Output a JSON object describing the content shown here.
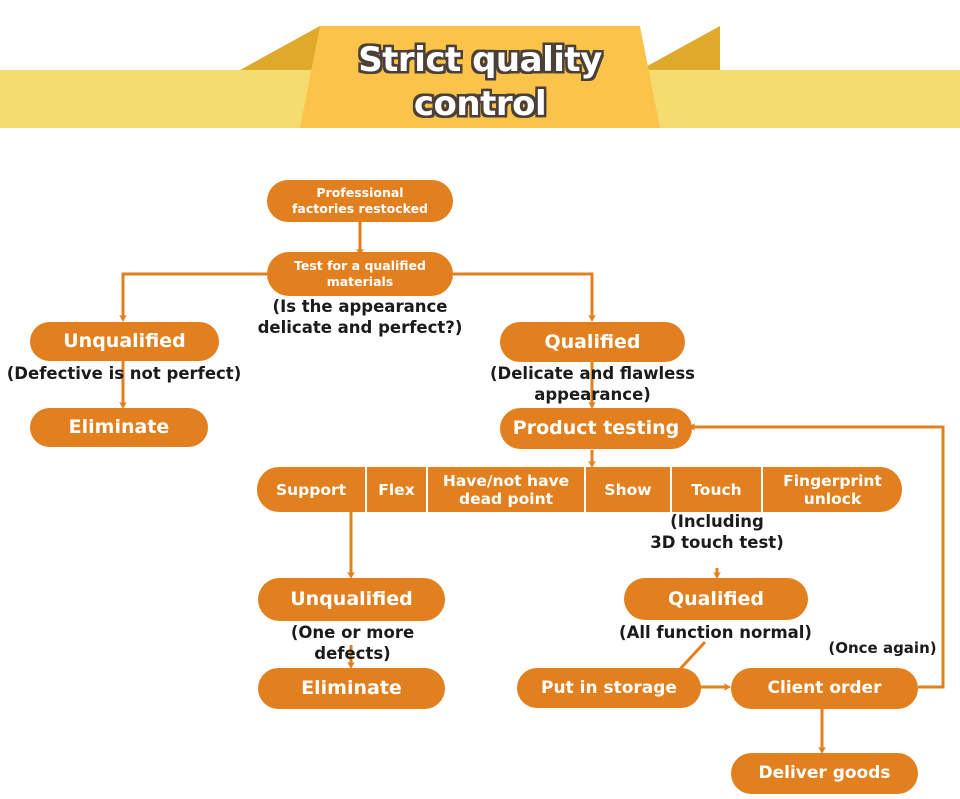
{
  "header": {
    "title": "Strict quality\ncontrol",
    "banner_light_color": "#F5DC6E",
    "banner_mid_color": "#FBC44A",
    "banner_dark_color": "#DFA92B"
  },
  "theme": {
    "pill_color": "#E2801F",
    "connector_color": "#E2801F",
    "caption_color": "#1b1b1b",
    "background": "#ffffff"
  },
  "flow": {
    "nodes": {
      "restocked": "Professional\nfactories restocked",
      "test_materials": "Test for a qualified\nmaterials",
      "unqualified_top": "Unqualified",
      "qualified_top": "Qualified",
      "eliminate_top": "Eliminate",
      "product_testing": "Product testing",
      "unqualified_bottom": "Unqualified",
      "qualified_bottom": "Qualified",
      "eliminate_bottom": "Eliminate",
      "put_in_storage": "Put in storage",
      "client_order": "Client order",
      "deliver_goods": "Deliver goods"
    },
    "captions": {
      "appearance_question": "(Is the appearance\ndelicate and perfect?)",
      "defective_note": "(Defective is not perfect)",
      "delicate_note": "(Delicate and flawless appearance)",
      "including_3d": "(Including\n3D touch test)",
      "one_or_more_defects": "(One or more defects)",
      "all_function_normal": "(All function normal)",
      "once_again": "(Once again)"
    },
    "test_items": [
      "Support",
      "Flex",
      "Have/not have\ndead point",
      "Show",
      "Touch",
      "Fingerprint\nunlock"
    ]
  }
}
